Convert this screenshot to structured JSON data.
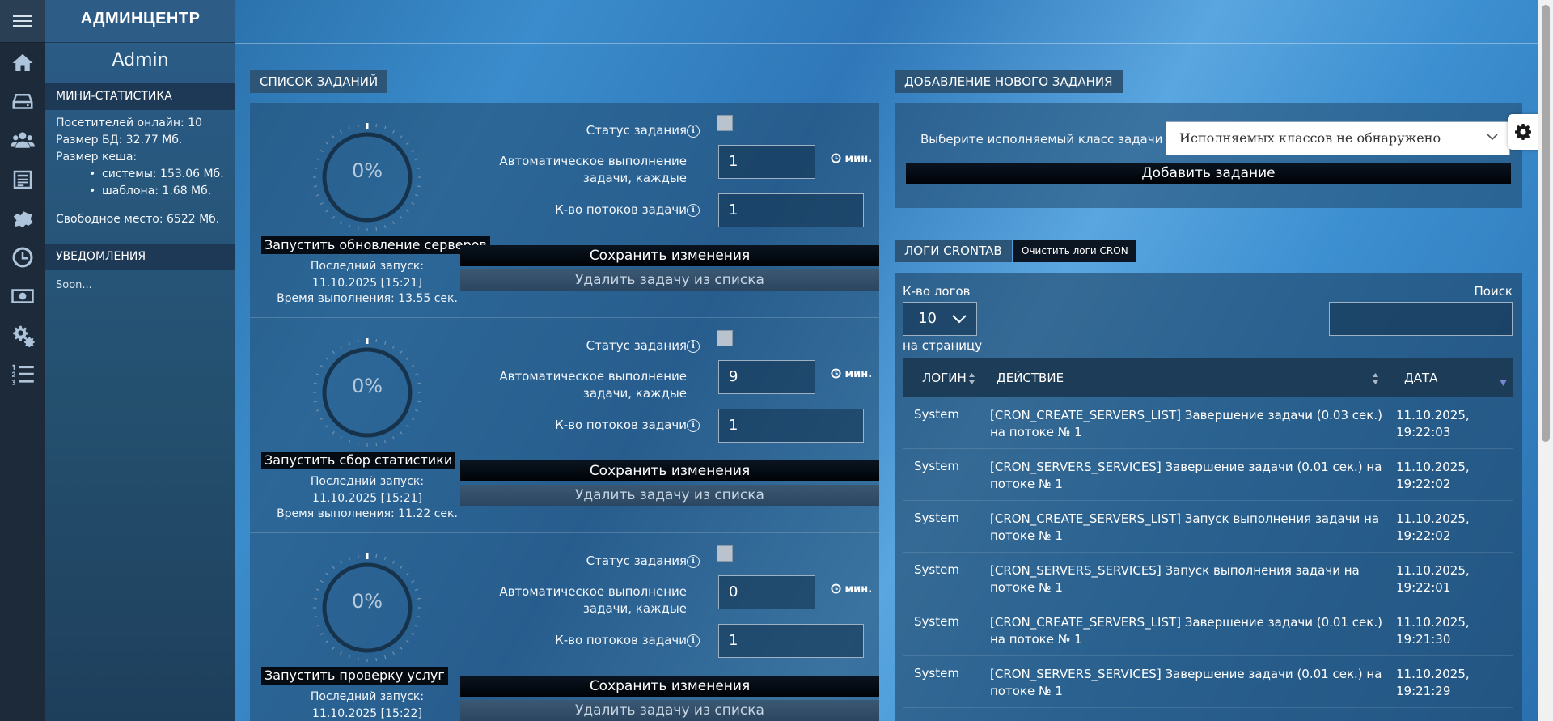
{
  "sidebar": {
    "brand": "АДМИНЦЕНТР",
    "user_name": "Admin",
    "mini_stats_title": "МИНИ-СТАТИСТИКА",
    "visitors_online": "Посетителей онлайн: 10",
    "db_size": "Размер БД: 32.77 Мб.",
    "cache_size_label": "Размер кеша:",
    "cache_system": "системы: 153.06 Мб.",
    "cache_templates": "шаблона: 1.68 Мб.",
    "free_space": "Свободное место: 6522 Мб.",
    "notifications_title": "УВЕДОМЛЕНИЯ",
    "notifications_text": "Soon..."
  },
  "rail_icons": [
    "home-icon",
    "storage-icon",
    "users-icon",
    "news-icon",
    "map-icon",
    "clock-icon",
    "money-icon",
    "gears-icon",
    "list-icon"
  ],
  "task_list": {
    "title": "СПИСОК ЗАДАНИЙ",
    "status_label": "Статус задания",
    "auto_label": "Автоматическое выполнение задачи, каждые",
    "threads_label": "К-во потоков задачи",
    "min_label": "мин.",
    "save_label": "Сохранить изменения",
    "delete_label": "Удалить задачу из списка",
    "tasks": [
      {
        "percent": "0%",
        "run_label": "Запустить обновление серверов",
        "last_run": "Последний запуск: 11.10.2025 [15:21]",
        "exec_time": "Время выполнения: 13.55 сек.",
        "interval": "1",
        "threads": "1"
      },
      {
        "percent": "0%",
        "run_label": "Запустить сбор статистики",
        "last_run": "Последний запуск: 11.10.2025 [15:21]",
        "exec_time": "Время выполнения: 11.22 сек.",
        "interval": "9",
        "threads": "1"
      },
      {
        "percent": "0%",
        "run_label": "Запустить проверку услуг",
        "last_run": "Последний запуск: 11.10.2025 [15:22]",
        "exec_time": "",
        "interval": "0",
        "threads": "1"
      }
    ]
  },
  "add_task": {
    "title": "ДОБАВЛЕНИЕ НОВОГО ЗАДАНИЯ",
    "class_label": "Выберите исполняемый класс задачи",
    "class_value": "Исполняемых классов не обнаружено",
    "add_label": "Добавить задание"
  },
  "logs": {
    "title": "ЛОГИ CRONTAB",
    "clear_label": "Очистить логи CRON",
    "per_page_label": "К-во логов",
    "per_page_value": "10",
    "per_page_suffix": "на страницу",
    "search_label": "Поиск",
    "columns": [
      "ЛОГИН",
      "ДЕЙСТВИЕ",
      "ДАТА"
    ],
    "rows": [
      {
        "login": "System",
        "action": "[CRON_CREATE_SERVERS_LIST] Завершение задачи (0.03 сек.) на потоке № 1",
        "date": "11.10.2025, 19:22:03"
      },
      {
        "login": "System",
        "action": "[CRON_SERVERS_SERVICES] Завершение задачи (0.01 сек.) на потоке № 1",
        "date": "11.10.2025, 19:22:02"
      },
      {
        "login": "System",
        "action": "[CRON_CREATE_SERVERS_LIST] Запуск выполнения задачи на потоке № 1",
        "date": "11.10.2025, 19:22:02"
      },
      {
        "login": "System",
        "action": "[CRON_SERVERS_SERVICES] Запуск выполнения задачи на потоке № 1",
        "date": "11.10.2025, 19:22:01"
      },
      {
        "login": "System",
        "action": "[CRON_CREATE_SERVERS_LIST] Завершение задачи (0.01 сек.) на потоке № 1",
        "date": "11.10.2025, 19:21:30"
      },
      {
        "login": "System",
        "action": "[CRON_SERVERS_SERVICES] Завершение задачи (0.01 сек.) на потоке № 1",
        "date": "11.10.2025, 19:21:29"
      }
    ]
  }
}
